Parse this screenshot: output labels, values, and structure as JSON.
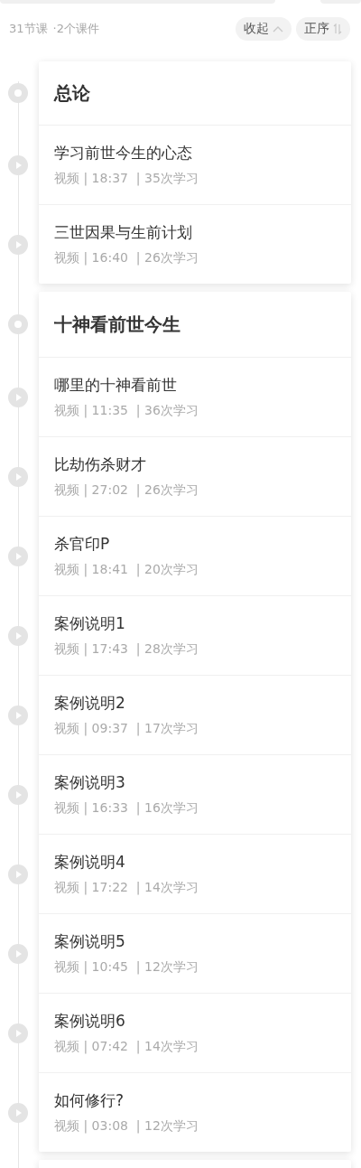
{
  "summary": {
    "lessons": "31节课",
    "files": "·2个课件"
  },
  "controls": [
    {
      "kind": "collapse",
      "label": "收起"
    },
    {
      "kind": "order",
      "label": "正序"
    }
  ],
  "sections": [
    {
      "title": "总论",
      "lessons": [
        {
          "title": "学习前世今生的心态",
          "meta": "视频 | 18:37  | 35次学习"
        },
        {
          "title": "三世因果与生前计划",
          "meta": "视频 | 16:40  | 26次学习"
        }
      ]
    },
    {
      "title": "十神看前世今生",
      "lessons": [
        {
          "title": "哪里的十神看前世",
          "meta": "视频 | 11:35  | 36次学习"
        },
        {
          "title": "比劫伤杀财才",
          "meta": "视频 | 27:02  | 26次学习"
        },
        {
          "title": "杀官印P",
          "meta": "视频 | 18:41  | 20次学习"
        },
        {
          "title": "案例说明1",
          "meta": "视频 | 17:43  | 28次学习"
        },
        {
          "title": "案例说明2",
          "meta": "视频 | 09:37  | 17次学习"
        },
        {
          "title": "案例说明3",
          "meta": "视频 | 16:33  | 16次学习"
        },
        {
          "title": "案例说明4",
          "meta": "视频 | 17:22  | 14次学习"
        },
        {
          "title": "案例说明5",
          "meta": "视频 | 10:45  | 12次学习"
        },
        {
          "title": "案例说明6",
          "meta": "视频 | 07:42  | 14次学习"
        },
        {
          "title": "如何修行?",
          "meta": "视频 | 03:08  | 12次学习"
        }
      ]
    }
  ]
}
